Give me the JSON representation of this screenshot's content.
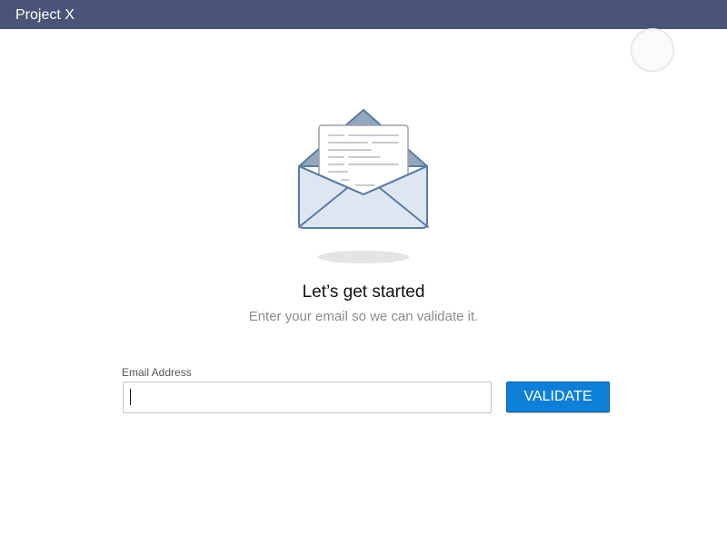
{
  "app": {
    "title": "Project X"
  },
  "hero": {
    "illustration_icon": "open-envelope-icon",
    "heading": "Let’s get started",
    "subheading": "Enter your email so we can validate it."
  },
  "form": {
    "email_label": "Email Address",
    "email_value": "",
    "email_placeholder": "",
    "validate_label": "VALIDATE"
  },
  "status": {
    "loading_icon": "loading-spinner-icon"
  },
  "colors": {
    "titlebar": "#4a5478",
    "accent": "#0f80d8",
    "envelope_fill": "#dde6f1",
    "envelope_stroke": "#5a7ca3",
    "envelope_flap": "#93a7bc"
  }
}
